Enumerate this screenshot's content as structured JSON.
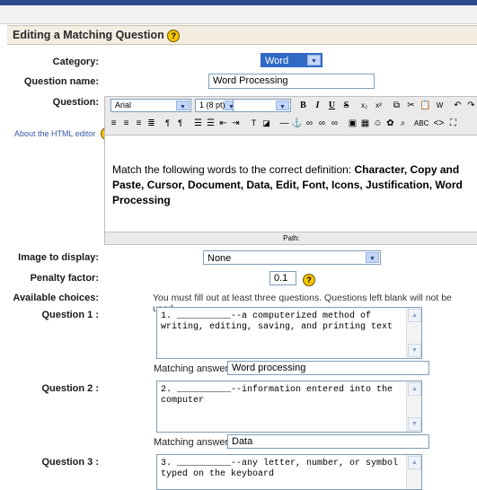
{
  "header": {
    "title": "Editing a Matching Question"
  },
  "form": {
    "category_label": "Category:",
    "category_value": "Word",
    "qname_label": "Question name:",
    "qname_value": "Word Processing",
    "question_label": "Question:",
    "about_html_editor": "About the HTML editor",
    "editor": {
      "font": "Arial",
      "size": "1 (8 pt)",
      "style": "",
      "content_plain": "Match the following words to the correct definition: ",
      "content_bold": "Character, Copy and Paste, Cursor, Document, Data, Edit, Font, Icons, Justification, Word Processing",
      "path_label": "Path:"
    },
    "image_label": "Image to display:",
    "image_value": "None",
    "penalty_label": "Penalty factor:",
    "penalty_value": "0.1",
    "choices_label": "Available choices:",
    "choices_note": "You must fill out at least three questions. Questions left blank will not be used.",
    "questions": [
      {
        "label": "Question 1 :",
        "text": "1. __________--a computerized method of writing, editing, saving, and printing text",
        "answer_label": "Matching answer 1",
        "answer": "Word processing"
      },
      {
        "label": "Question 2 :",
        "text": "2. __________--information entered into the computer",
        "answer_label": "Matching answer 2",
        "answer": "Data"
      },
      {
        "label": "Question 3 :",
        "text": "3. __________--any letter, number, or symbol typed on the keyboard"
      }
    ]
  },
  "colors": {
    "header_bg": "#f3ede2",
    "help_icon": "#f6c400",
    "selected_option": "#316ac5"
  }
}
